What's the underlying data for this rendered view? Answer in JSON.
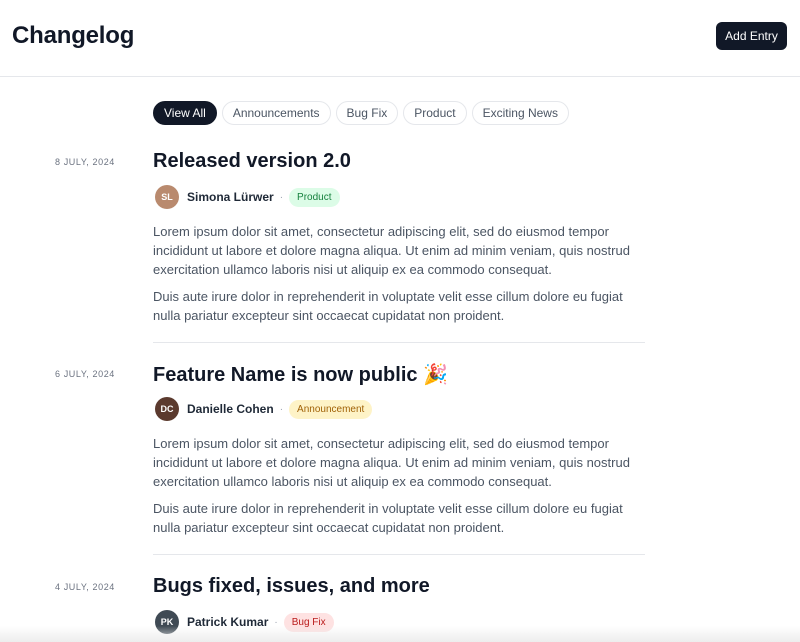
{
  "header": {
    "title": "Changelog",
    "add_button": "Add Entry"
  },
  "filters": [
    "View All",
    "Announcements",
    "Bug Fix",
    "Product",
    "Exciting News"
  ],
  "entries": [
    {
      "date": "8 JULY, 2024",
      "title": "Released version 2.0",
      "author": "Simona Lürwer",
      "author_initials": "SL",
      "tag": "Product",
      "paragraphs": [
        "Lorem ipsum dolor sit amet, consectetur adipiscing elit, sed do eiusmod tempor incididunt ut labore et dolore magna aliqua. Ut enim ad minim veniam, quis nostrud exercitation ullamco laboris nisi ut aliquip ex ea commodo consequat.",
        "Duis aute irure dolor in reprehenderit in voluptate velit esse cillum dolore eu fugiat nulla pariatur excepteur sint occaecat cupidatat non proident."
      ]
    },
    {
      "date": "6 JULY, 2024",
      "title": "Feature Name is now public 🎉",
      "author": "Danielle Cohen",
      "author_initials": "DC",
      "tag": "Announcement",
      "paragraphs": [
        "Lorem ipsum dolor sit amet, consectetur adipiscing elit, sed do eiusmod tempor incididunt ut labore et dolore magna aliqua. Ut enim ad minim veniam, quis nostrud exercitation ullamco laboris nisi ut aliquip ex ea commodo consequat.",
        "Duis aute irure dolor in reprehenderit in voluptate velit esse cillum dolore eu fugiat nulla pariatur excepteur sint occaecat cupidatat non proident."
      ]
    },
    {
      "date": "4 JULY, 2024",
      "title": "Bugs fixed, issues, and more",
      "author": "Patrick Kumar",
      "author_initials": "PK",
      "tag": "Bug Fix"
    }
  ],
  "colors": {
    "primary": "#111827",
    "product_bg": "#dcfce7",
    "announcement_bg": "#fef3c7",
    "bugfix_bg": "#fee2e2"
  }
}
